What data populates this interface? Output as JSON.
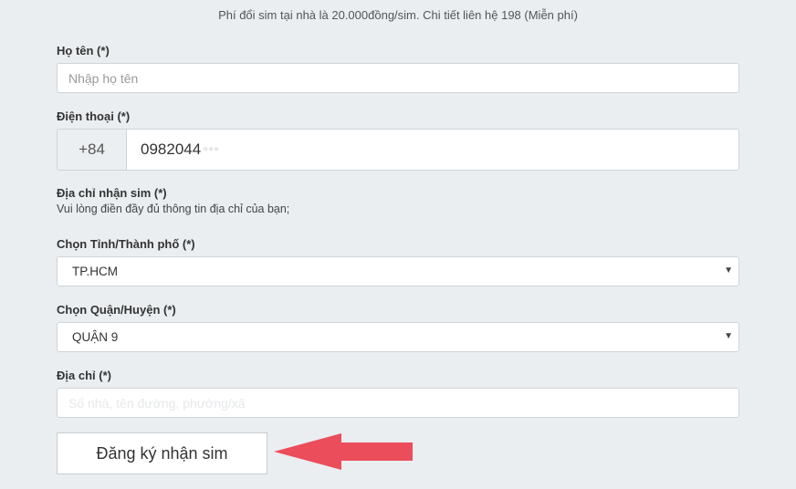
{
  "notice": "Phí đổi sim tại nhà là 20.000đồng/sim. Chi tiết liên hệ 198 (Miễn phí)",
  "name_field": {
    "label": "Họ tên (*)",
    "placeholder": "Nhập họ tên",
    "value": ""
  },
  "phone_field": {
    "label": "Điện thoại (*)",
    "prefix": "+84",
    "value": "0982044",
    "blurred_suffix": "•••"
  },
  "address_section": {
    "label": "Địa chỉ nhận sim (*)",
    "hint": "Vui lòng điền đầy đủ thông tin địa chỉ của bạn;"
  },
  "province_select": {
    "label": "Chọn Tỉnh/Thành phố (*)",
    "selected": "TP.HCM"
  },
  "district_select": {
    "label": "Chọn Quận/Huyện (*)",
    "selected": "QUẬN 9"
  },
  "address_field": {
    "label": "Địa chỉ (*)",
    "placeholder": "Số nhà, tên đường, phường/xã"
  },
  "submit": {
    "label": "Đăng ký nhận sim"
  },
  "colors": {
    "background": "#eaeef1",
    "arrow": "#ec4d5b",
    "border": "#cfd4d8"
  },
  "icons": {
    "select_arrow": "chevron-down-icon",
    "pointer": "arrow-left-icon"
  }
}
